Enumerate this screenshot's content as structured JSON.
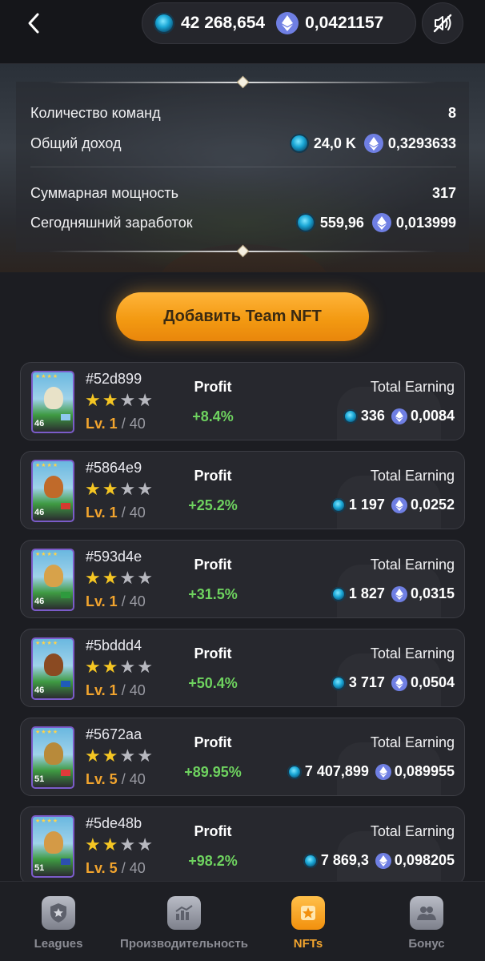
{
  "header": {
    "coin_balance": "42 268,654",
    "eth_balance": "0,0421157"
  },
  "stats": {
    "teams_label": "Количество команд",
    "teams_value": "8",
    "income_label": "Общий доход",
    "income_coin": "24,0 K",
    "income_eth": "0,3293633",
    "power_label": "Суммарная мощность",
    "power_value": "317",
    "today_label": "Сегодняшний заработок",
    "today_coin": "559,96",
    "today_eth": "0,013999"
  },
  "add_button": {
    "label": "Добавить Team NFT"
  },
  "nfts": [
    {
      "id": "#52d899",
      "stars": 2,
      "stars_total": 4,
      "level": "Lv. 1",
      "max_level": "/ 40",
      "profit_label": "Profit",
      "profit": "+8.4%",
      "earning_label": "Total Earning",
      "earning_coin": "336",
      "earning_eth": "0,0084",
      "rating": "46",
      "art_color": "#e8e2c8",
      "flag_color": "#8fc8ee"
    },
    {
      "id": "#5864e9",
      "stars": 2,
      "stars_total": 4,
      "level": "Lv. 1",
      "max_level": "/ 40",
      "profit_label": "Profit",
      "profit": "+25.2%",
      "earning_label": "Total Earning",
      "earning_coin": "1 197",
      "earning_eth": "0,0252",
      "rating": "46",
      "art_color": "#c06a2a",
      "flag_color": "#d43b2f"
    },
    {
      "id": "#593d4e",
      "stars": 2,
      "stars_total": 4,
      "level": "Lv. 1",
      "max_level": "/ 40",
      "profit_label": "Profit",
      "profit": "+31.5%",
      "earning_label": "Total Earning",
      "earning_coin": "1 827",
      "earning_eth": "0,0315",
      "rating": "46",
      "art_color": "#d7a24a",
      "flag_color": "#2e9a3e"
    },
    {
      "id": "#5bddd4",
      "stars": 2,
      "stars_total": 4,
      "level": "Lv. 1",
      "max_level": "/ 40",
      "profit_label": "Profit",
      "profit": "+50.4%",
      "earning_label": "Total Earning",
      "earning_coin": "3 717",
      "earning_eth": "0,0504",
      "rating": "46",
      "art_color": "#8a4a22",
      "flag_color": "#1f5bb8"
    },
    {
      "id": "#5672aa",
      "stars": 2,
      "stars_total": 4,
      "level": "Lv. 5",
      "max_level": "/ 40",
      "profit_label": "Profit",
      "profit": "+89.95%",
      "earning_label": "Total Earning",
      "earning_coin": "7 407,899",
      "earning_eth": "0,089955",
      "rating": "51",
      "art_color": "#b88a3a",
      "flag_color": "#e03a3a"
    },
    {
      "id": "#5de48b",
      "stars": 2,
      "stars_total": 4,
      "level": "Lv. 5",
      "max_level": "/ 40",
      "profit_label": "Profit",
      "profit": "+98.2%",
      "earning_label": "Total Earning",
      "earning_coin": "7 869,3",
      "earning_eth": "0,098205",
      "rating": "51",
      "art_color": "#d49a46",
      "flag_color": "#2c4fb0"
    }
  ],
  "nav": [
    {
      "label": "Leagues",
      "icon": "league-badge-icon",
      "active": false
    },
    {
      "label": "Производительность",
      "icon": "chart-icon",
      "active": false
    },
    {
      "label": "NFTs",
      "icon": "star-icon",
      "active": true
    },
    {
      "label": "Бонус",
      "icon": "people-icon",
      "active": false
    }
  ],
  "colors": {
    "accent": "#f39a12",
    "profit": "#6ed25f",
    "eth": "#6f7fe3",
    "coin": "#1aa7d6"
  }
}
